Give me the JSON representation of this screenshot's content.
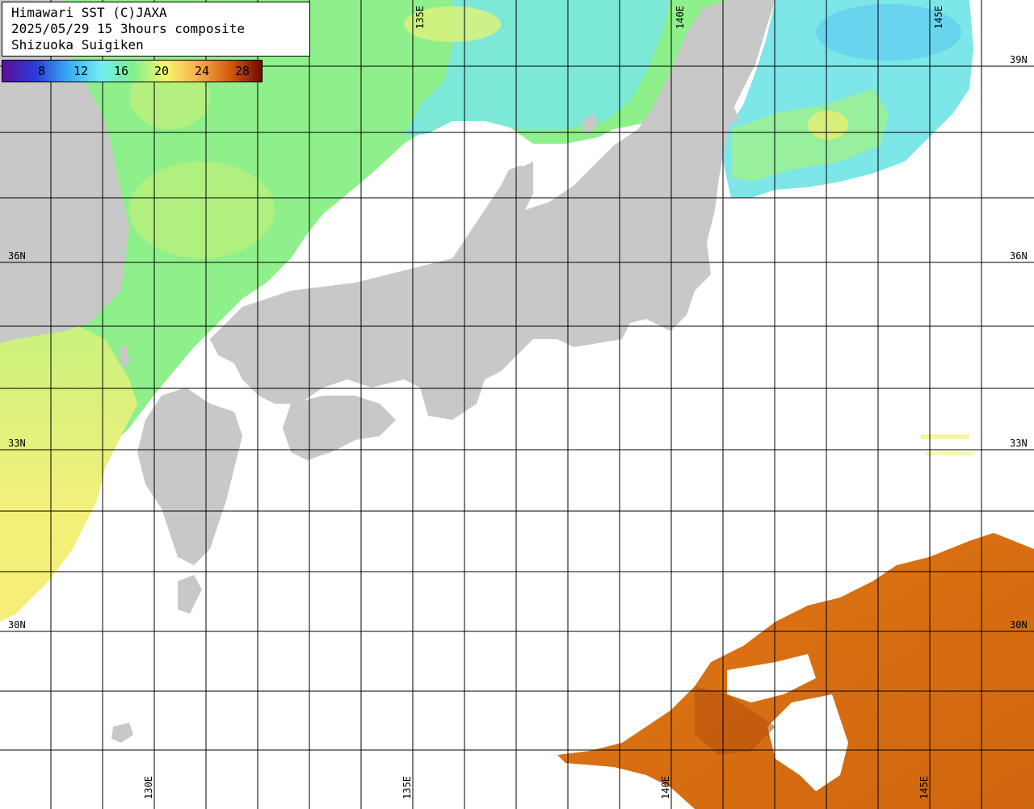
{
  "title": {
    "line1": "Himawari SST (C)JAXA",
    "line2": "2025/05/29 15 3hours composite",
    "line3": "Shizuoka Suigiken"
  },
  "colorbar": {
    "ticks": [
      "8",
      "12",
      "16",
      "20",
      "24",
      "28"
    ],
    "colors": [
      "#5a0f9a",
      "#2a3cd8",
      "#39a8f2",
      "#72eef2",
      "#7df08e",
      "#f5f56e",
      "#f6b24c",
      "#d3580c",
      "#6e0a05"
    ]
  },
  "latitude_labels": [
    "39N",
    "36N",
    "33N",
    "30N"
  ],
  "longitude_labels": [
    "130E",
    "135E",
    "140E",
    "145E"
  ],
  "colors": {
    "land": "#c8c8c8",
    "no_data": "#ffffff",
    "grid": "#000000",
    "sst_cool": "#7df08e",
    "sst_cold": "#72e8f2",
    "sst_warm_yellow": "#eef27a",
    "sst_hot": "#d96f14"
  }
}
